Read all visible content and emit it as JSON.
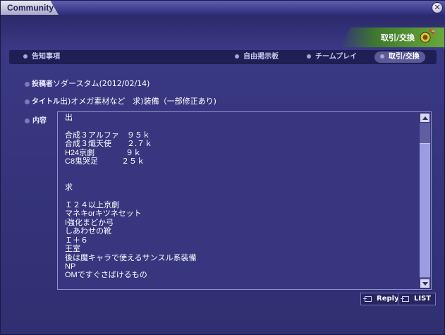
{
  "window": {
    "title": "Community"
  },
  "header": {
    "board_badge": "取引/交換"
  },
  "tabs": [
    {
      "label": "告知事項",
      "active": false
    },
    {
      "label": "自由掲示板",
      "active": false
    },
    {
      "label": "チームプレイ",
      "active": false
    },
    {
      "label": "取引/交換",
      "active": true
    }
  ],
  "post": {
    "author_label": "投稿者",
    "author_value": "ソダースタム(2012/02/14)",
    "title_label": "タイトル",
    "title_value": "出)オメガ素材など　求)装備（一部修正あり)",
    "content_label": "内容",
    "content_text": "出\n\n合成３アルファ　９５ｋ\n合成３熾天使　　２.７ｋ\nH24京劇　　　　９ｋ\nC8鬼哭足　　　２５ｋ\n\n\n求\n\nＩ２４以上京劇\nマネキorキツネセット\nI強化まどか弓\nしあわせの靴\nＩ＋６\n王室\n後は魔キャラで使えるサンスル系装備\nNP\nOMですぐさばけるもの",
    "scroll_position": 0.92
  },
  "buttons": {
    "reply": "Reply",
    "list": "LIST"
  }
}
